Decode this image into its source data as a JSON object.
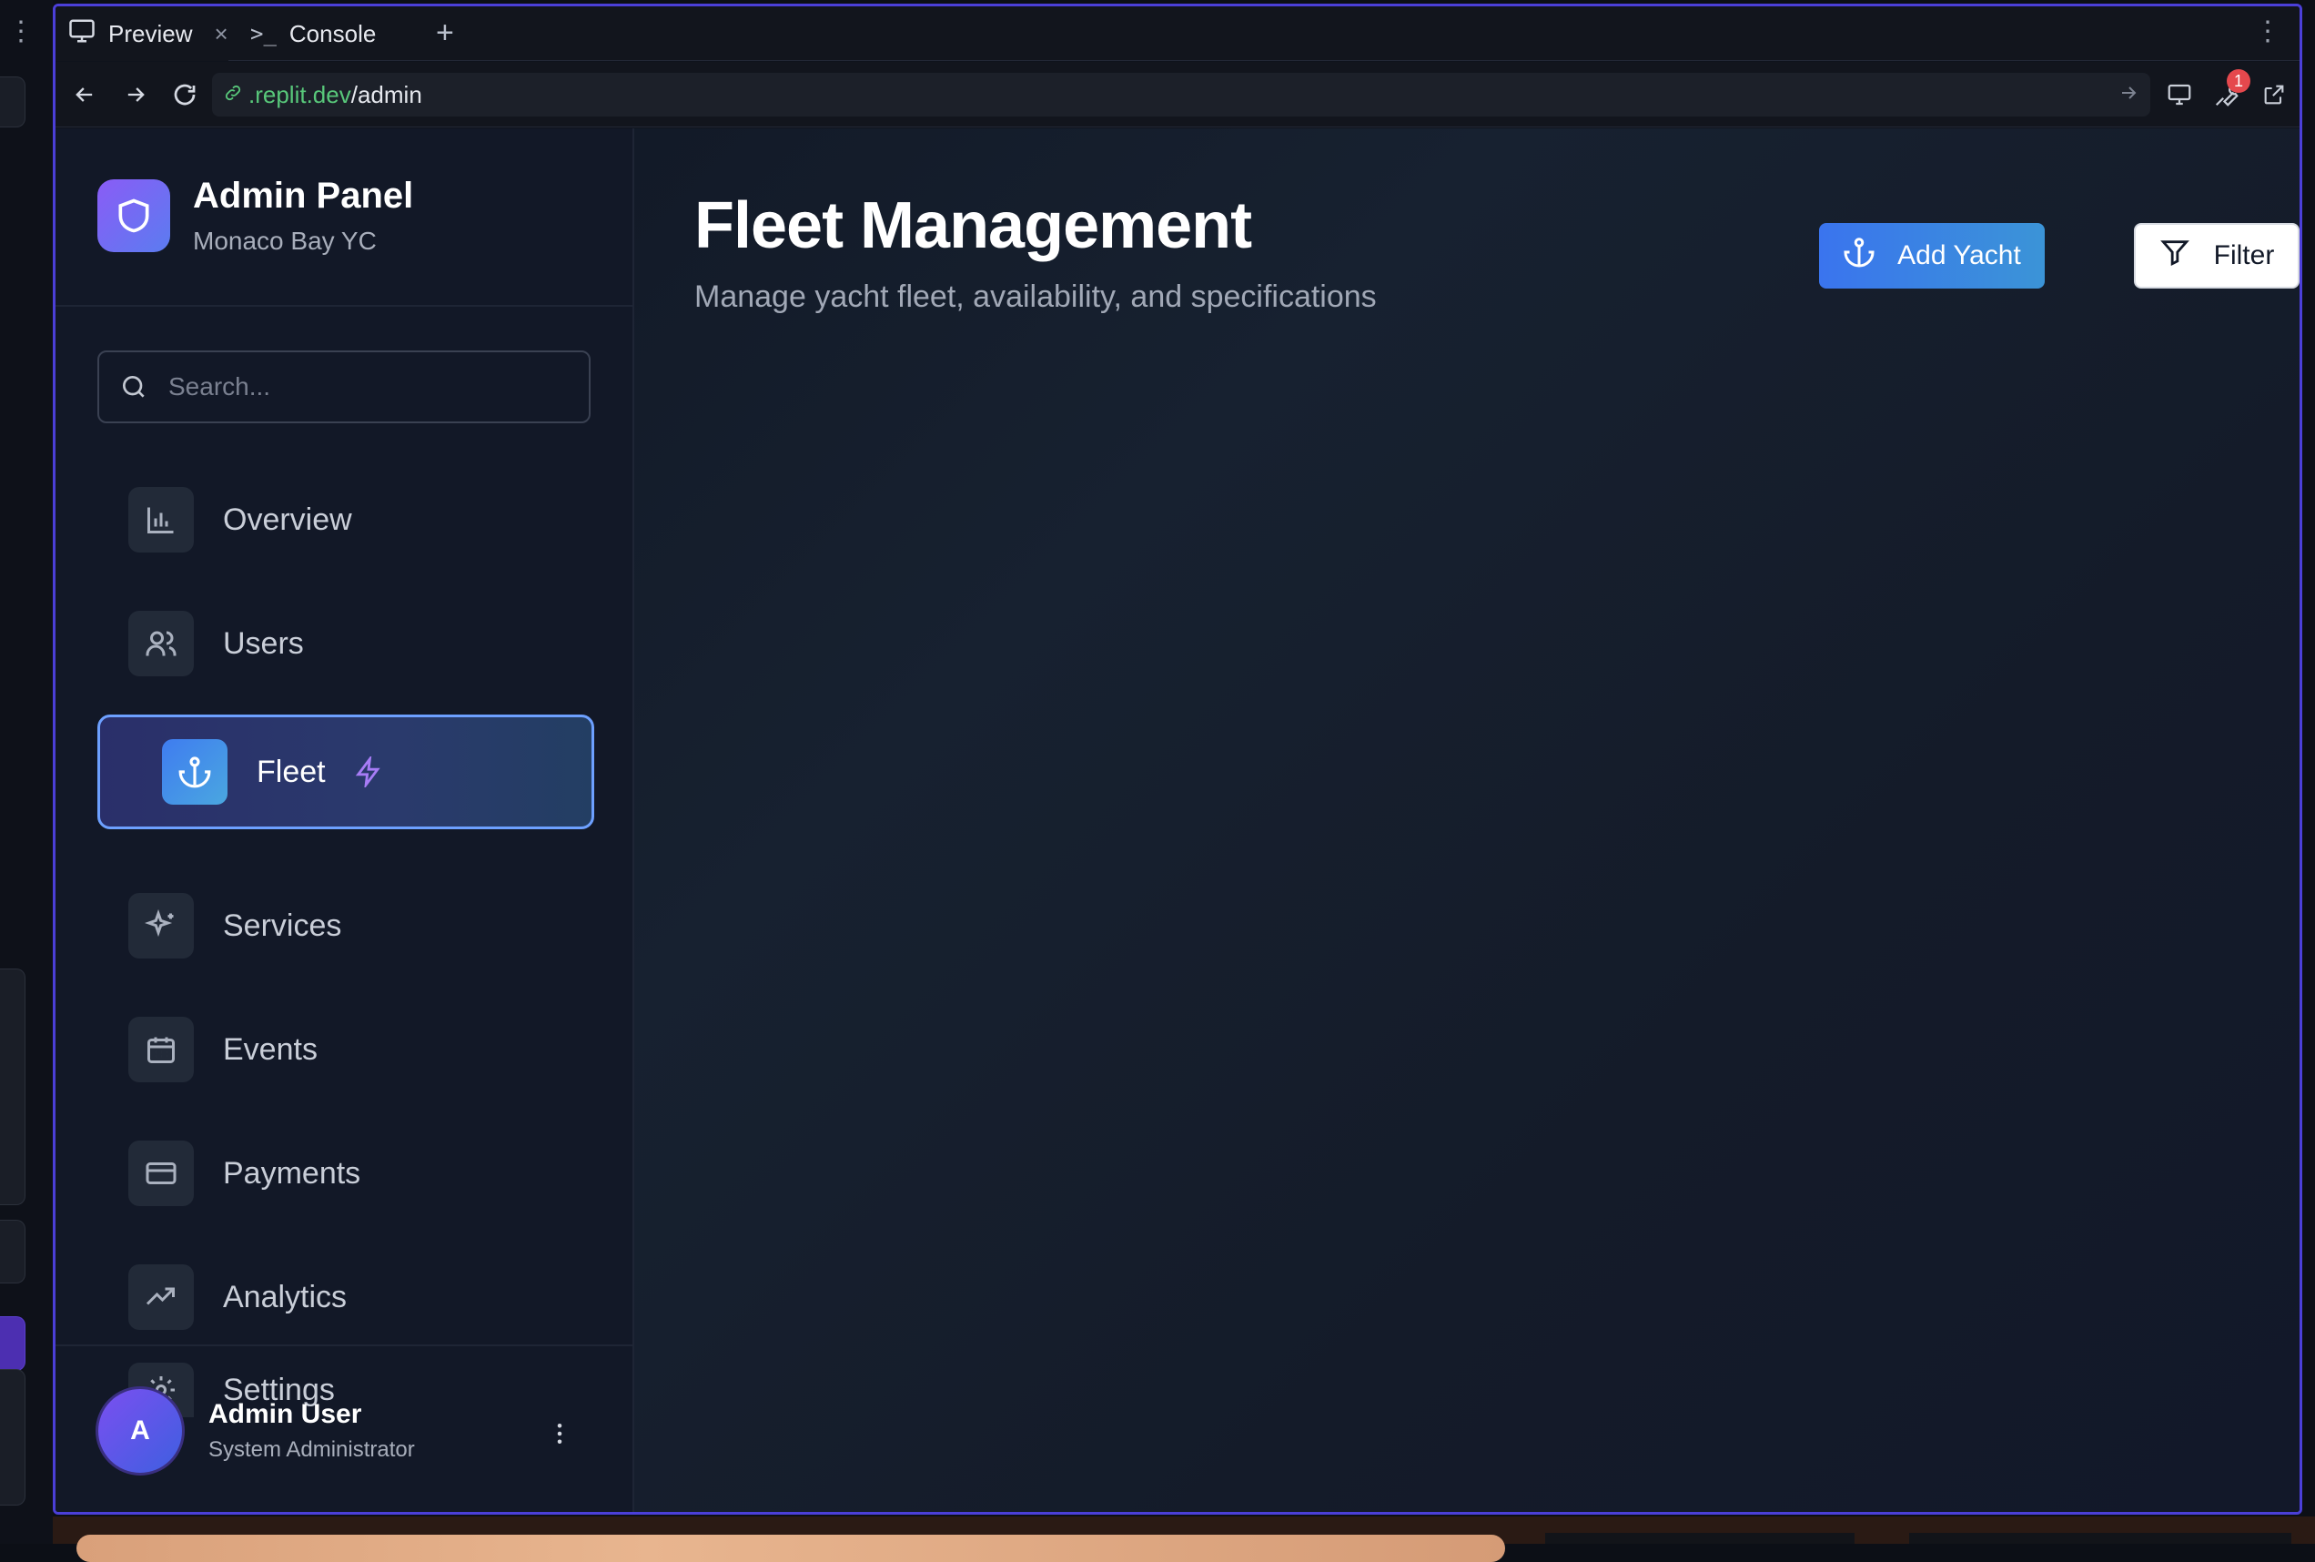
{
  "browser": {
    "tabs": [
      {
        "label": "Preview",
        "icon": "monitor-icon",
        "active": true
      },
      {
        "label": "Console",
        "icon": "terminal-icon",
        "active": false
      }
    ],
    "url_host": ".replit.dev",
    "url_path": "/admin",
    "notification_count": "1"
  },
  "sidebar": {
    "brand_title": "Admin Panel",
    "brand_subtitle": "Monaco Bay YC",
    "search_placeholder": "Search...",
    "items": [
      {
        "label": "Overview",
        "icon": "bar-chart-icon"
      },
      {
        "label": "Users",
        "icon": "users-icon"
      },
      {
        "label": "Fleet",
        "icon": "anchor-icon",
        "active": true
      },
      {
        "label": "Services",
        "icon": "sparkle-icon"
      },
      {
        "label": "Events",
        "icon": "calendar-icon"
      },
      {
        "label": "Payments",
        "icon": "credit-card-icon"
      },
      {
        "label": "Analytics",
        "icon": "trending-up-icon"
      },
      {
        "label": "Settings",
        "icon": "gear-icon"
      }
    ],
    "user": {
      "initial": "A",
      "name": "Admin User",
      "role": "System Administrator"
    }
  },
  "main": {
    "title": "Fleet Management",
    "subtitle": "Manage yacht fleet, availability, and specifications",
    "add_button": "Add Yacht",
    "filter_button": "Filter"
  },
  "colors": {
    "accent": "#3a74ee",
    "active_border": "#6da0ff",
    "brand_gradient_start": "#8a5cf6",
    "frame_border": "#4b3fd8"
  }
}
